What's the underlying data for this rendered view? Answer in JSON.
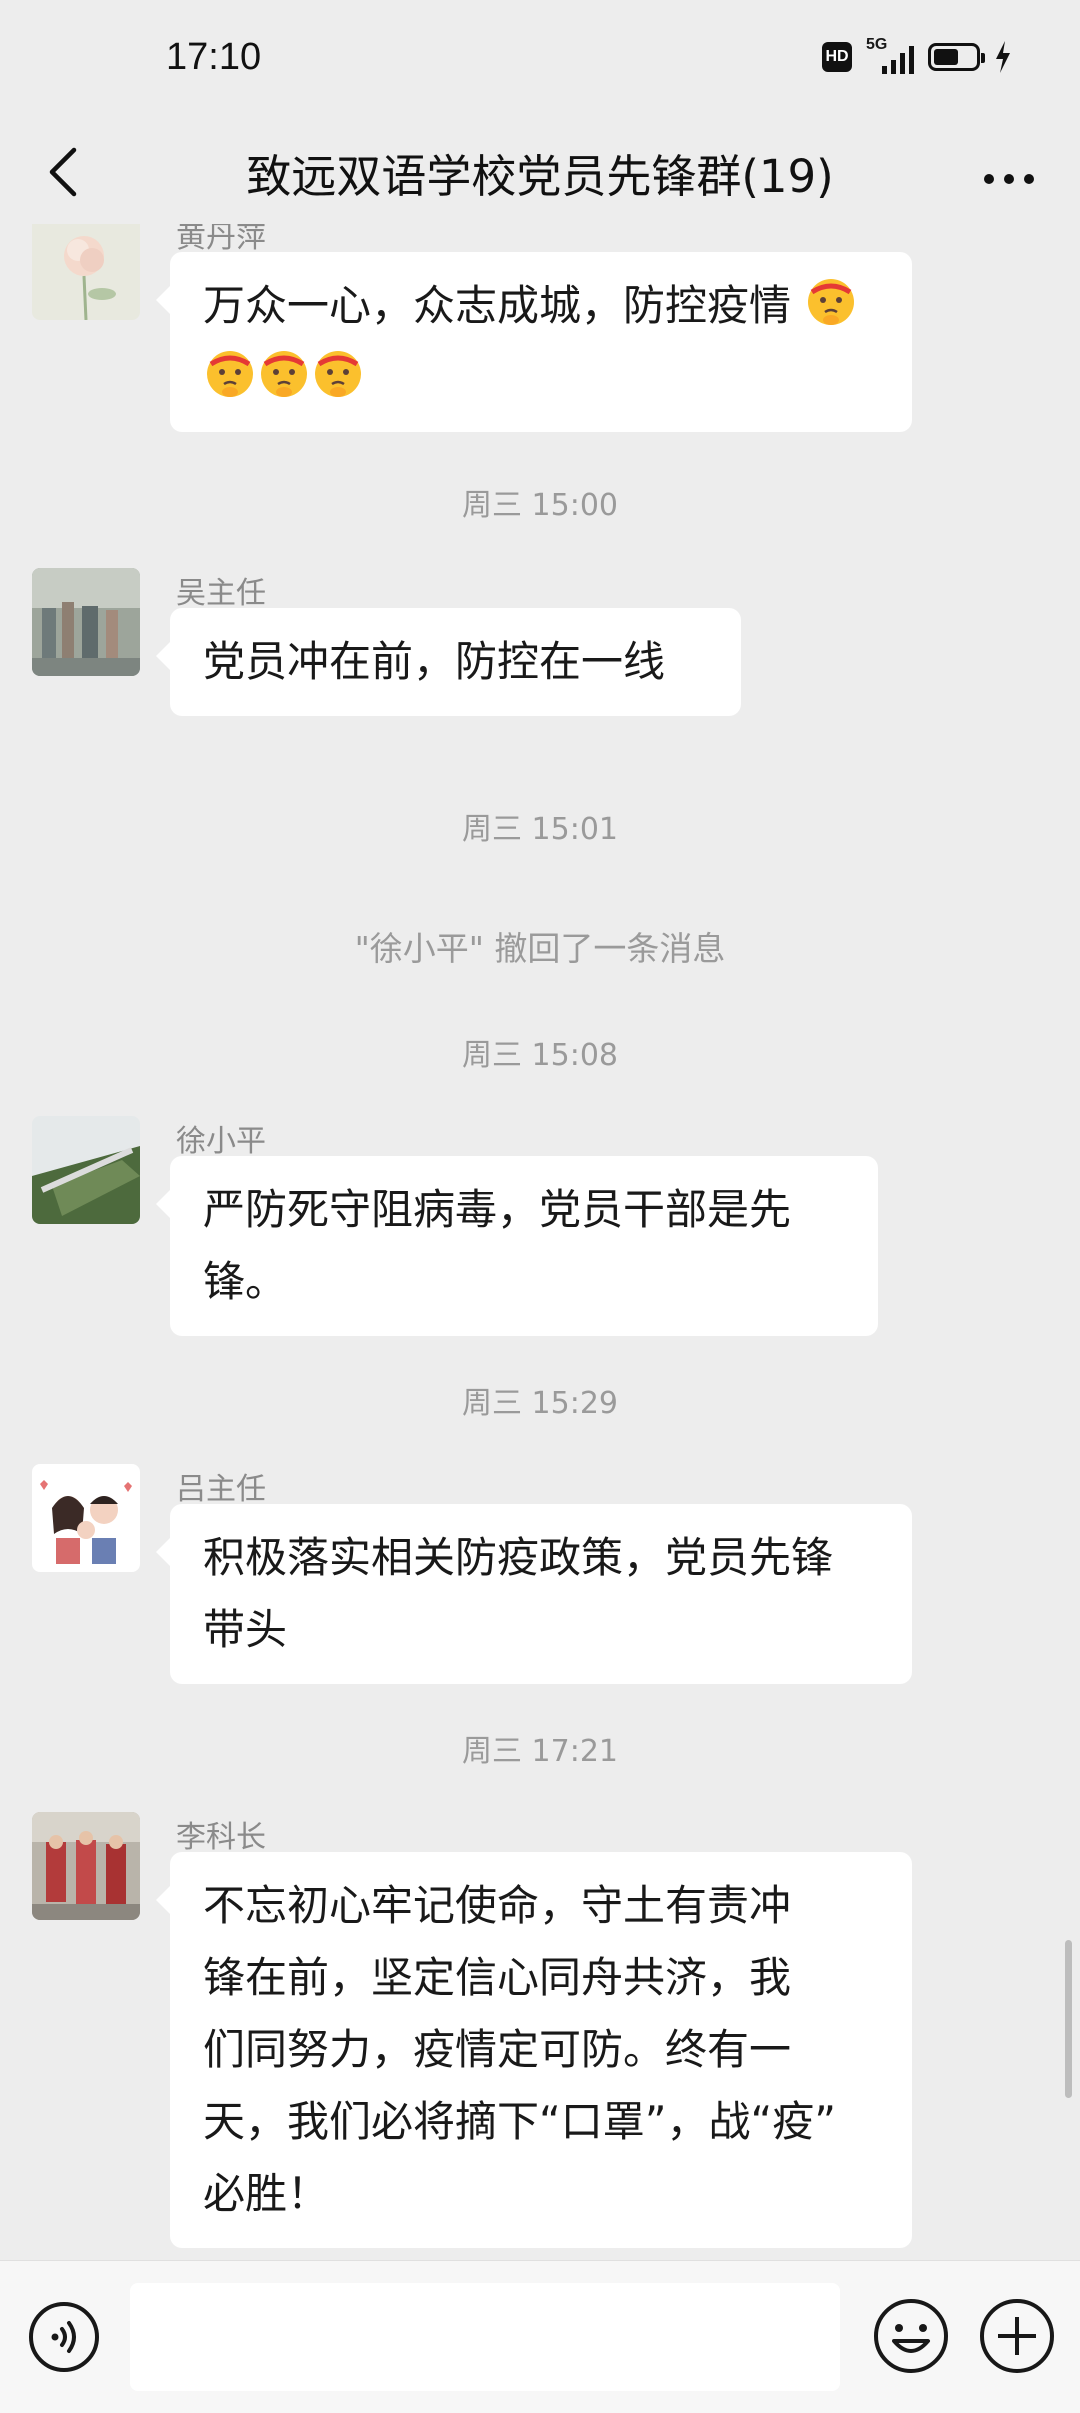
{
  "status_bar": {
    "time": "17:10",
    "network": "5G",
    "hd_badge": "HD",
    "battery_level_percent": 60
  },
  "header": {
    "title": "致远双语学校党员先锋群(19)"
  },
  "messages": [
    {
      "sender": "黄丹萍",
      "text_lines": [
        "万众一心，众志成城，防控疫情"
      ],
      "emoji_count": 4
    },
    {
      "time": "周三 15:00"
    },
    {
      "sender": "吴主任",
      "text": "党员冲在前，防控在一线"
    },
    {
      "time": "周三 15:01"
    },
    {
      "system": "\"徐小平\" 撤回了一条消息"
    },
    {
      "time": "周三 15:08"
    },
    {
      "sender": "徐小平",
      "text": "严防死守阻病毒，党员干部是先\n锋。"
    },
    {
      "time": "周三 15:29"
    },
    {
      "sender": "吕主任",
      "text": "积极落实相关防疫政策，党员先锋\n带头"
    },
    {
      "time": "周三 17:21"
    },
    {
      "sender": "李科长",
      "text": "不忘初心牢记使命，守土有责冲\n锋在前，坚定信心同舟共济，我\n们同努力，疫情定可防。终有一\n天，我们必将摘下“口罩”，战“疫”\n必胜！"
    }
  ],
  "icons": {
    "back": "chevron-left-icon",
    "more": "more-icon",
    "voice": "voice-icon",
    "emoji": "emoji-icon",
    "plus": "plus-icon",
    "reaction_emoji": "shushing-face-emoji"
  },
  "colors": {
    "background": "#ededed",
    "bubble": "#ffffff",
    "meta_text": "#9a9a9a"
  }
}
